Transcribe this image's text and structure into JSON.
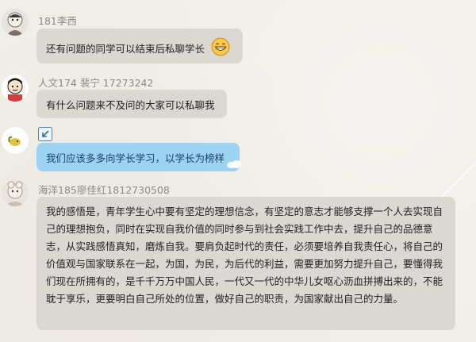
{
  "messages": [
    {
      "sender": "181李西",
      "text": "还有问题的同学可以结束后私聊学长"
    },
    {
      "sender": "人文174 裴宁 17273242",
      "text": "有什么问题来不及问的大家可以私聊我"
    },
    {
      "sender": "",
      "text": "我们应该多多向学长学习，以学长为榜样"
    },
    {
      "sender": "海洋185廖佳红1812730508",
      "text": "我的感悟是，青年学生心中要有坚定的理想信念，有坚定的意志才能够支撑一个人去实现自己的理想抱负，同时在实现自我价值的同时参与到社会实践工作中去，提升自己的品德意志，从实践感悟真知，磨炼自我。要肩负起时代的责任，必须要培养自我责任心，将自己的价值观与国家联系在一起，为国，为民，为后代的利益，需要更加努力提升自己，要懂得我们现在所拥有的，是千千万万中国人民，一代又一代的中华儿女呕心沥血拼搏出来的，不能耽于享乐，更要明白自己所处的位置，做好自己的职责，为国家献出自己的力量。"
    }
  ],
  "icons": {
    "grin_emoji": "grinning-face-emoji",
    "quote_icon": "reply-arrow-icon"
  },
  "colors": {
    "bubble_gray": "#dbd8d3",
    "bubble_blue": "#9cd3f3",
    "name_gray": "#8a8a8a"
  }
}
